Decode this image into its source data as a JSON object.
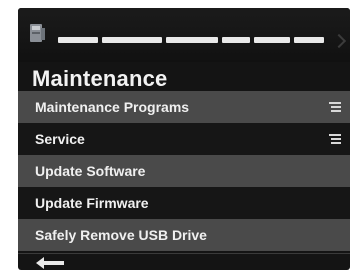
{
  "header": {
    "title": "Maintenance",
    "device_icon": "printer-device-icon",
    "progress_icon": "progress-bar-icon"
  },
  "menu": {
    "items": [
      {
        "label": "Maintenance Programs",
        "has_submenu": true
      },
      {
        "label": "Service",
        "has_submenu": true
      },
      {
        "label": "Update Software",
        "has_submenu": false
      },
      {
        "label": "Update Firmware",
        "has_submenu": false
      },
      {
        "label": "Safely Remove USB Drive",
        "has_submenu": false
      }
    ]
  },
  "footer": {
    "back_icon": "back-arrow-icon"
  },
  "colors": {
    "background": "#141414",
    "item_light": "#4a4a4a",
    "item_dark": "#161616",
    "text": "#f0f0f0"
  }
}
